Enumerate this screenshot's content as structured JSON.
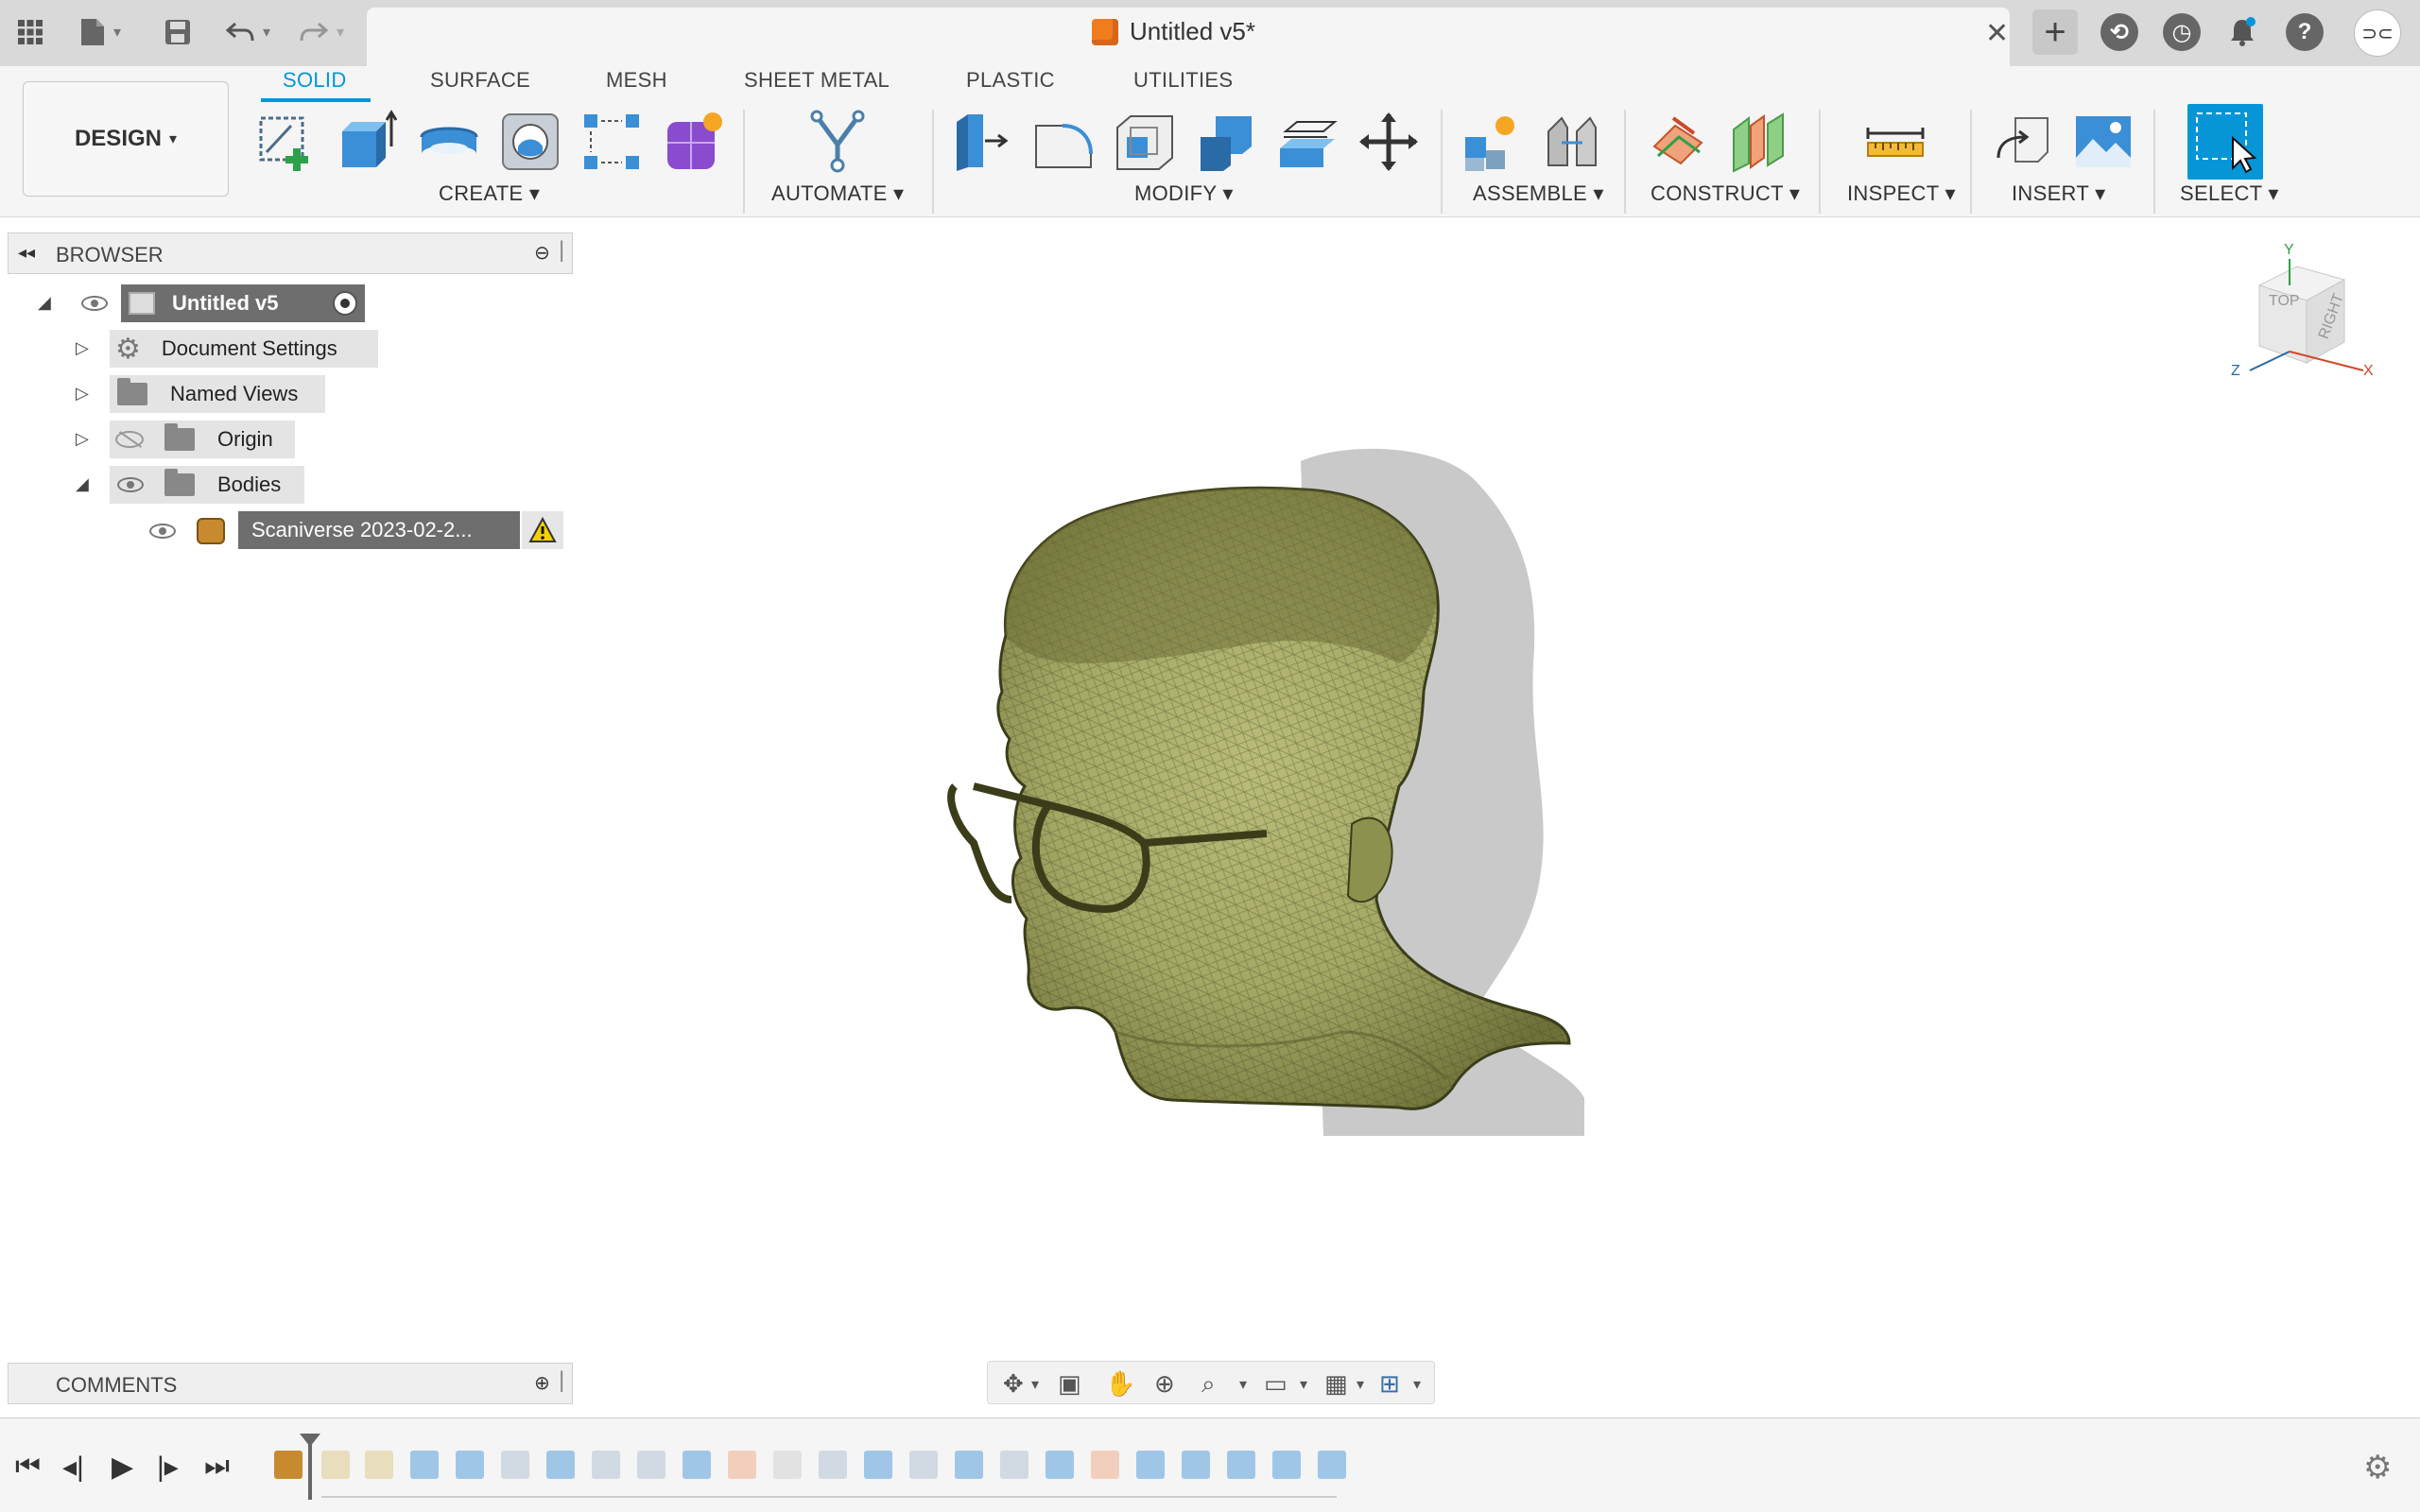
{
  "titlebar": {
    "document_title": "Untitled v5*",
    "icons": [
      "apps-grid-icon",
      "file-icon",
      "save-icon",
      "undo-icon",
      "redo-icon",
      "close-tab-icon",
      "new-tab-icon",
      "extensions-icon",
      "job-status-icon",
      "notifications-icon",
      "help-icon",
      "account-icon"
    ]
  },
  "ribbon": {
    "workspace_label": "DESIGN",
    "tabs": [
      {
        "label": "SOLID",
        "active": true
      },
      {
        "label": "SURFACE",
        "active": false
      },
      {
        "label": "MESH",
        "active": false
      },
      {
        "label": "SHEET METAL",
        "active": false
      },
      {
        "label": "PLASTIC",
        "active": false
      },
      {
        "label": "UTILITIES",
        "active": false
      }
    ],
    "groups": {
      "create": "CREATE",
      "automate": "AUTOMATE",
      "modify": "MODIFY",
      "assemble": "ASSEMBLE",
      "construct": "CONSTRUCT",
      "inspect": "INSPECT",
      "insert": "INSERT",
      "select": "SELECT"
    },
    "accent_color": "#0696d7"
  },
  "browser": {
    "title": "BROWSER",
    "root": "Untitled v5",
    "items": [
      {
        "label": "Document Settings",
        "icon": "gear-icon"
      },
      {
        "label": "Named Views",
        "icon": "folder-icon"
      },
      {
        "label": "Origin",
        "icon": "folder-icon",
        "visible": false
      },
      {
        "label": "Bodies",
        "icon": "folder-icon"
      }
    ],
    "body_item": "Scaniverse 2023-02-2...",
    "warning_icon": "warning-icon"
  },
  "comments": {
    "title": "COMMENTS"
  },
  "viewcube": {
    "top": "TOP",
    "right": "RIGHT",
    "axis_x": "X",
    "axis_y": "Y",
    "axis_z": "Z"
  },
  "model": {
    "mesh_color": "#a9ad6a",
    "shadow_color": "#c9c9c9"
  },
  "navbar": {
    "icons": [
      "orbit-icon",
      "look-at-icon",
      "pan-icon",
      "zoom-icon",
      "zoom-window-icon",
      "display-settings-icon",
      "grid-icon",
      "viewports-icon"
    ]
  },
  "timeline": {
    "controls": [
      "first-icon",
      "previous-icon",
      "play-icon",
      "next-icon",
      "last-icon"
    ],
    "feature_count": 24
  }
}
